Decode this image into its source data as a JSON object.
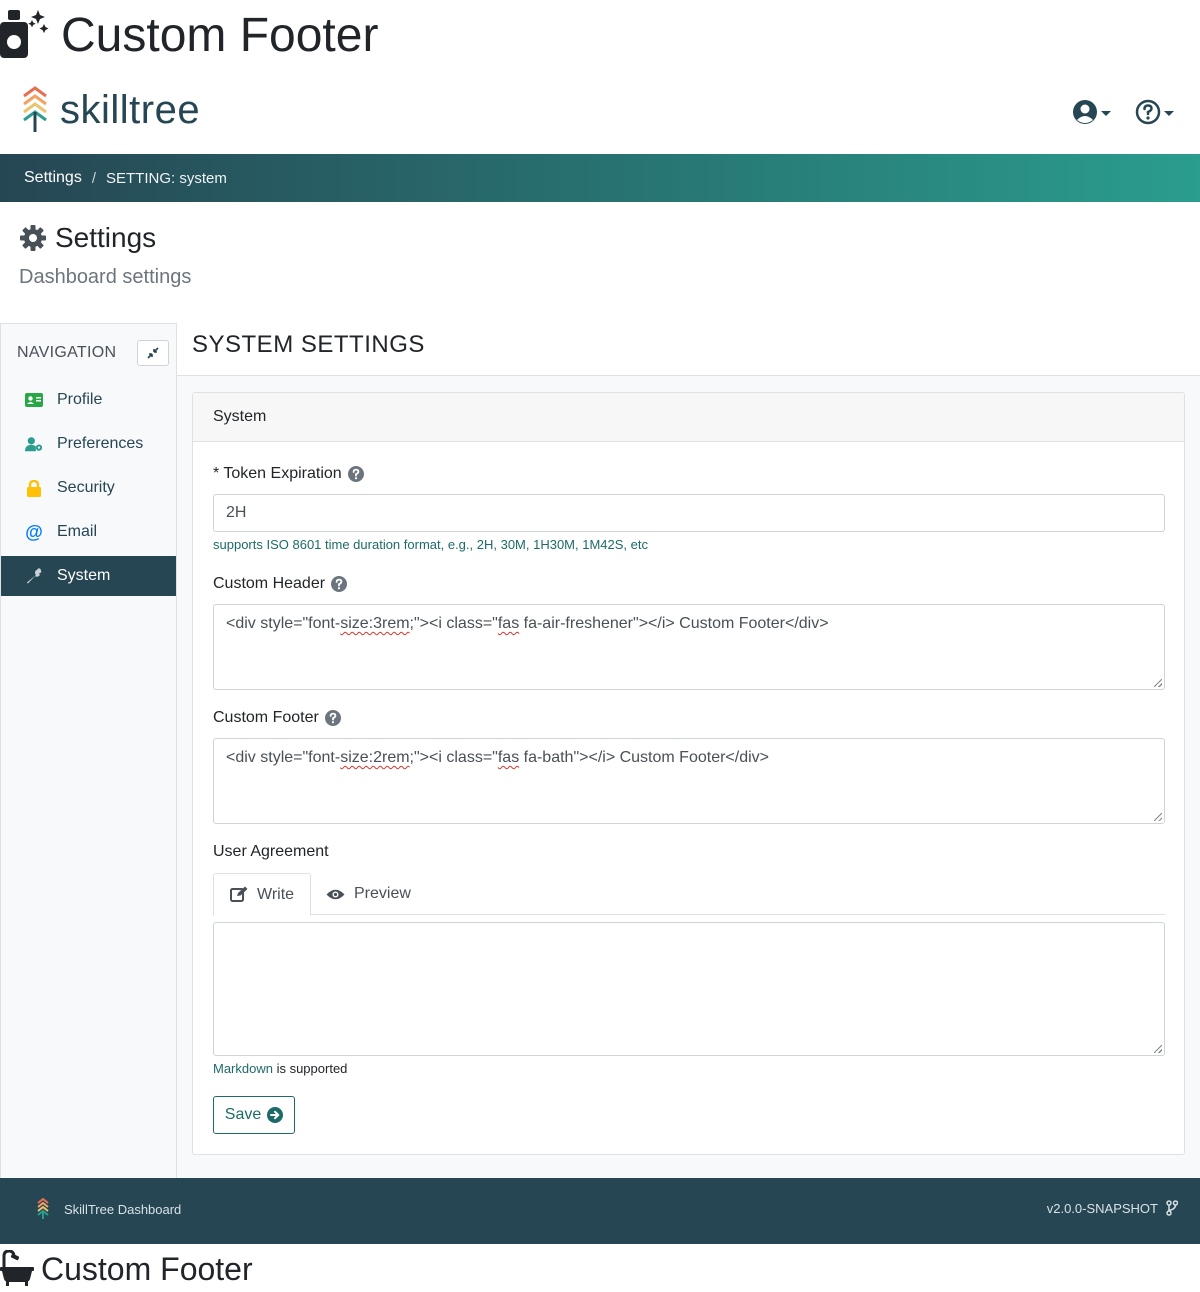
{
  "custom_header": {
    "text": "Custom Footer",
    "icon": "air-freshener-icon"
  },
  "nav": {
    "brand": "skilltree",
    "user_menu_icon": "user-circle-icon",
    "help_menu_icon": "question-circle-icon"
  },
  "breadcrumb": {
    "root": "Settings",
    "separator": "/",
    "current": "SETTING: system"
  },
  "page": {
    "title": "Settings",
    "subtitle": "Dashboard settings",
    "icon": "gear-icon"
  },
  "sidebar": {
    "title": "NAVIGATION",
    "items": [
      {
        "label": "Profile",
        "icon": "id-card-icon",
        "color": "#28a745"
      },
      {
        "label": "Preferences",
        "icon": "user-cog-icon",
        "color": "#2a9d8f"
      },
      {
        "label": "Security",
        "icon": "lock-icon",
        "color": "#ffc107"
      },
      {
        "label": "Email",
        "icon": "at-icon",
        "color": "#007bff"
      },
      {
        "label": "System",
        "icon": "wrench-icon",
        "color": "#ffffff"
      }
    ]
  },
  "main": {
    "title": "SYSTEM SETTINGS",
    "card_title": "System",
    "token": {
      "label": "* Token Expiration",
      "value": "2H",
      "help": "supports ISO 8601 time duration format, e.g., 2H, 30M, 1H30M, 1M42S, etc"
    },
    "custom_header": {
      "label": "Custom Header",
      "value_parts": [
        "<div style=\"font-",
        "size:3rem",
        ";\"><i class=\"",
        "fas",
        " fa-air-freshener\"></i> Custom Footer</div>"
      ]
    },
    "custom_footer": {
      "label": "Custom Footer",
      "value_parts": [
        "<div style=\"font-",
        "size:2rem",
        ";\"><i class=\"",
        "fas",
        " fa-bath\"></i> Custom Footer</div>"
      ]
    },
    "user_agreement": {
      "label": "User Agreement",
      "tab_write": "Write",
      "tab_preview": "Preview",
      "value": "",
      "markdown_link": "Markdown",
      "markdown_suffix": " is supported"
    },
    "save_label": "Save"
  },
  "footer": {
    "brand": "SkillTree Dashboard",
    "version": "v2.0.0-SNAPSHOT"
  },
  "custom_footer": {
    "text": "Custom Footer",
    "icon": "bath-icon"
  },
  "colors": {
    "primary_dark": "#264653",
    "accent": "#2a9d8f",
    "link": "#1d6b68"
  }
}
